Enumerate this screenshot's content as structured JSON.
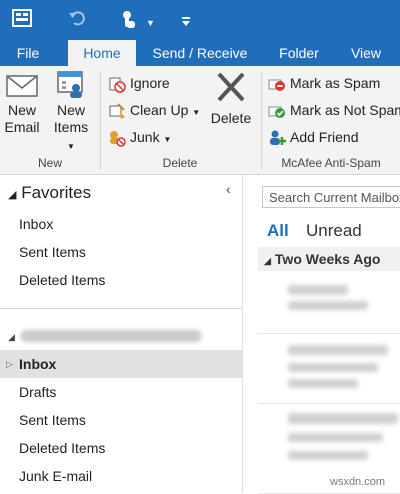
{
  "titlebar": {
    "icons": [
      "app-icon",
      "undo-icon",
      "touch-mode-icon",
      "dropdown-arrow-icon",
      "customize-quick-access-icon"
    ]
  },
  "tabs": [
    {
      "label": "File"
    },
    {
      "label": "Home"
    },
    {
      "label": "Send / Receive"
    },
    {
      "label": "Folder"
    },
    {
      "label": "View"
    }
  ],
  "ribbon": {
    "new_group": {
      "new_email": "New\nEmail",
      "new_email_l1": "New",
      "new_email_l2": "Email",
      "new_items_l1": "New",
      "new_items_l2": "Items",
      "label": "New"
    },
    "delete_group": {
      "ignore": "Ignore",
      "clean_up": "Clean Up",
      "junk": "Junk",
      "delete": "Delete",
      "label": "Delete"
    },
    "spam_group": {
      "mark_spam": "Mark as Spam",
      "mark_not_spam": "Mark as Not Spam",
      "add_friend": "Add Friend",
      "label": "McAfee Anti-Spam"
    }
  },
  "folders": {
    "favorites_title": "Favorites",
    "favorites": [
      "Inbox",
      "Sent Items",
      "Deleted Items"
    ],
    "account_items": [
      "Inbox",
      "Drafts",
      "Sent Items",
      "Deleted Items",
      "Junk E-mail"
    ],
    "selected": "Inbox"
  },
  "messages": {
    "search_placeholder": "Search Current Mailbox",
    "filter_all": "All",
    "filter_unread": "Unread",
    "group_header": "Two Weeks Ago"
  },
  "watermark": "wsxdn.com",
  "colors": {
    "accent": "#1e6ebc",
    "selection": "#e1e1e1",
    "ribbon_bg": "#f3f3f3"
  }
}
